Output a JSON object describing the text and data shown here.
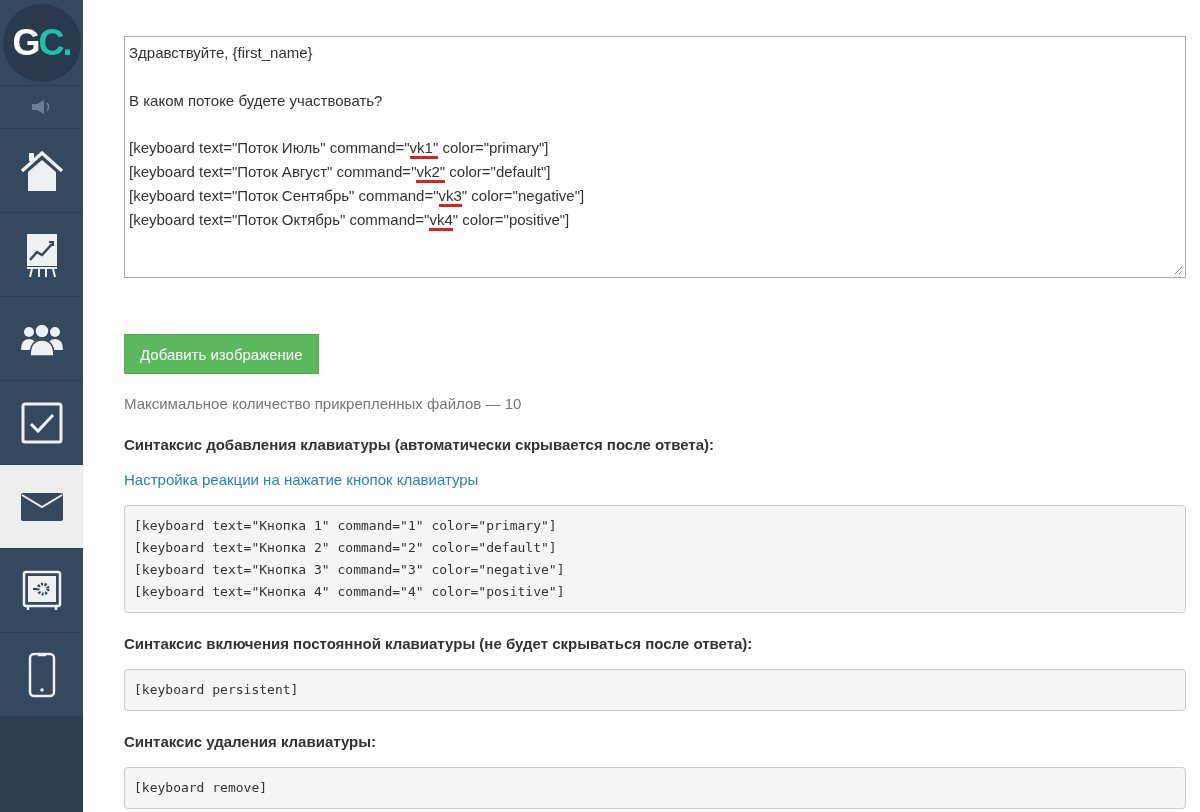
{
  "sidebar": {
    "logo": {
      "letters": "G",
      "accent": "C."
    },
    "items": [
      {
        "kind": "sound",
        "selected": false
      },
      {
        "kind": "home",
        "selected": false
      },
      {
        "kind": "chart",
        "selected": false
      },
      {
        "kind": "users",
        "selected": false
      },
      {
        "kind": "tasks",
        "selected": false
      },
      {
        "kind": "mail",
        "selected": true
      },
      {
        "kind": "safe",
        "selected": false
      },
      {
        "kind": "phone",
        "selected": false
      }
    ]
  },
  "message": {
    "paragraphs": [
      [
        [
          {
            "text": "Здравствуйте, {first_name}",
            "underlined": false
          }
        ]
      ],
      [
        [
          {
            "text": "В каком потоке будете участвовать?",
            "underlined": false
          }
        ]
      ],
      [
        [
          {
            "text": "[keyboard text=\"Поток Июль\" command=\"",
            "underlined": false
          },
          {
            "text": "vk1\"",
            "underlined": true
          },
          {
            "text": " color=\"primary\"]",
            "underlined": false
          }
        ],
        [
          {
            "text": "[keyboard text=\"Поток Август\" command=\"",
            "underlined": false
          },
          {
            "text": "vk2\"",
            "underlined": true
          },
          {
            "text": " color=\"default\"]",
            "underlined": false
          }
        ],
        [
          {
            "text": "[keyboard text=\"Поток Сентябрь\" command=\"",
            "underlined": false
          },
          {
            "text": "vk3",
            "underlined": true
          },
          {
            "text": "\" color=\"negative\"]",
            "underlined": false
          }
        ],
        [
          {
            "text": "[keyboard text=\"Поток Октябрь\" command=\"",
            "underlined": false
          },
          {
            "text": "vk4",
            "underlined": true
          },
          {
            "text": "\" color=\"positive\"]",
            "underlined": false
          }
        ]
      ]
    ]
  },
  "add_image_button": "Добавить изображение",
  "attachments_note": "Максимальное количество прикрепленных файлов — 10",
  "sections": [
    {
      "kind": "heading",
      "text": "Синтаксис добавления клавиатуры (автоматически скрывается после ответа):"
    },
    {
      "kind": "link",
      "text": "Настройка реакции на нажатие кнопок клавиатуры"
    },
    {
      "kind": "code",
      "lines": [
        "[keyboard text=\"Кнопка 1\" command=\"1\" color=\"primary\"]",
        "[keyboard text=\"Кнопка 2\" command=\"2\" color=\"default\"]",
        "[keyboard text=\"Кнопка 3\" command=\"3\" color=\"negative\"]",
        "[keyboard text=\"Кнопка 4\" command=\"4\" color=\"positive\"]"
      ]
    },
    {
      "kind": "heading",
      "text": "Синтаксис включения постоянной клавиатуры (не будет скрываться после ответа):"
    },
    {
      "kind": "code",
      "lines": [
        "[keyboard persistent]"
      ]
    },
    {
      "kind": "heading",
      "text": "Синтаксис удаления клавиатуры:"
    },
    {
      "kind": "code",
      "lines": [
        "[keyboard remove]"
      ]
    }
  ]
}
